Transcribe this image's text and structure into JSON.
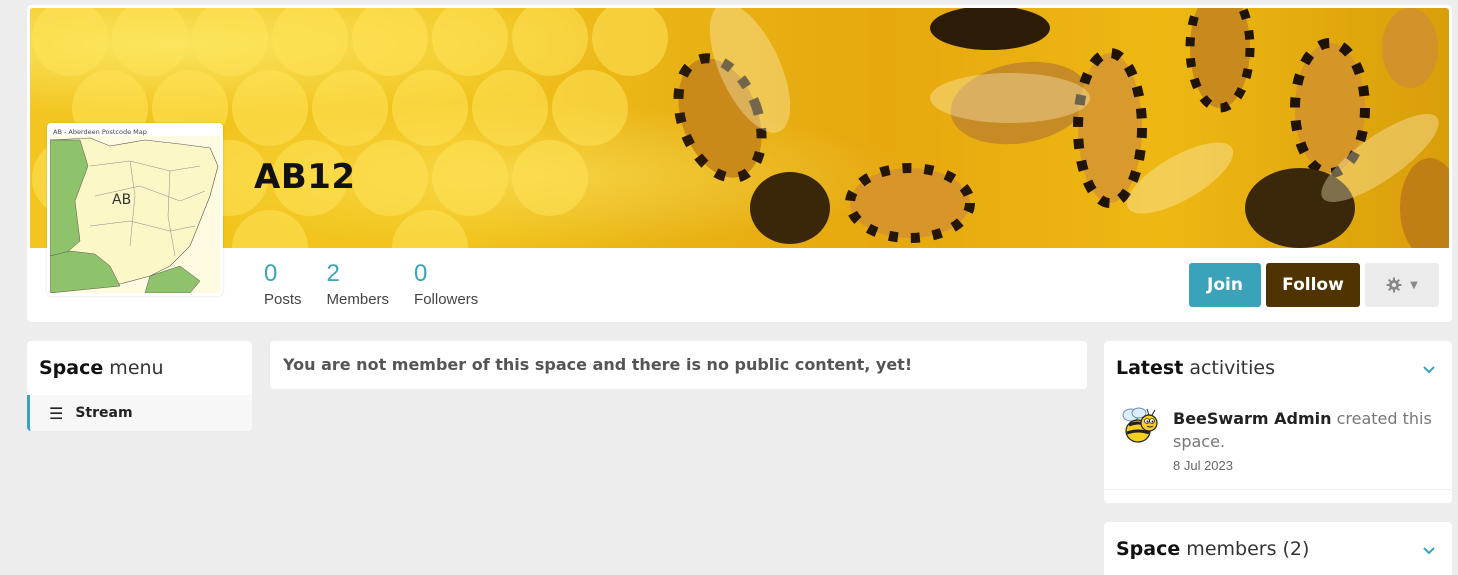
{
  "space": {
    "name": "AB12",
    "avatar_map_title": "AB - Aberdeen Postcode Map",
    "avatar_map_label": "AB"
  },
  "stats": [
    {
      "value": "0",
      "label": "Posts"
    },
    {
      "value": "2",
      "label": "Members"
    },
    {
      "value": "0",
      "label": "Followers"
    }
  ],
  "actions": {
    "join_label": "Join",
    "follow_label": "Follow"
  },
  "space_menu": {
    "heading_bold": "Space",
    "heading_rest": " menu",
    "items": [
      {
        "label": "Stream",
        "icon": "bars-icon"
      }
    ]
  },
  "notice": {
    "text": "You are not member of this space and there is no public content, yet!"
  },
  "latest_activities": {
    "heading_bold": "Latest",
    "heading_rest": " activities",
    "items": [
      {
        "user": "BeeSwarm Admin",
        "action": " created this space.",
        "date": "8 Jul 2023"
      }
    ]
  },
  "space_members": {
    "heading_bold": "Space",
    "heading_rest": " members (2)"
  },
  "colors": {
    "accent": "#3aa3ba",
    "follow": "#4f3300",
    "banner": "#f2c41c"
  }
}
